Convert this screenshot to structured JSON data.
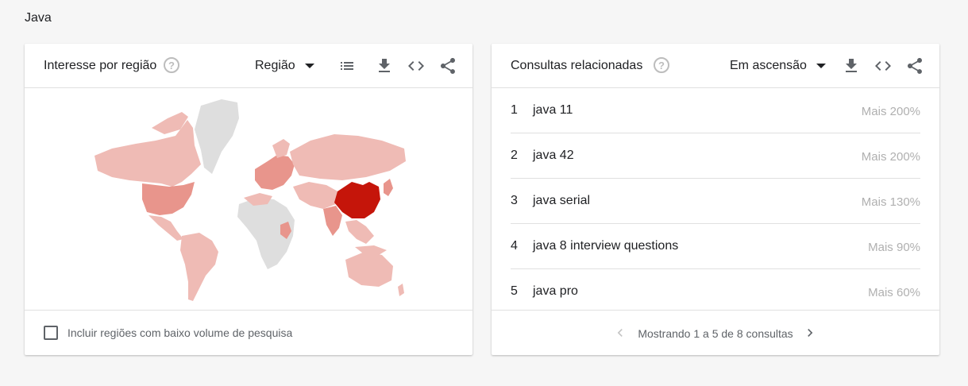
{
  "page": {
    "title": "Java"
  },
  "left_card": {
    "title": "Interesse por região",
    "help_symbol": "?",
    "dropdown_label": "Região",
    "icons": [
      "list-icon",
      "download-icon",
      "embed-icon",
      "share-icon"
    ],
    "checkbox_label": "Incluir regiões com baixo volume de pesquisa",
    "map": {
      "highlight_color": "#c5150a",
      "secondary_color": "#e8958c",
      "low_color": "#efbbb5",
      "no_data_color": "#dedede",
      "top_region": "China"
    }
  },
  "right_card": {
    "title": "Consultas relacionadas",
    "help_symbol": "?",
    "dropdown_label": "Em ascensão",
    "icons": [
      "download-icon",
      "embed-icon",
      "share-icon"
    ],
    "queries": [
      {
        "rank": "1",
        "text": "java 11",
        "value": "Mais 200%"
      },
      {
        "rank": "2",
        "text": "java 42",
        "value": "Mais 200%"
      },
      {
        "rank": "3",
        "text": "java serial",
        "value": "Mais 130%"
      },
      {
        "rank": "4",
        "text": "java 8 interview questions",
        "value": "Mais 90%"
      },
      {
        "rank": "5",
        "text": "java pro",
        "value": "Mais 60%"
      }
    ],
    "pager_text": "Mostrando 1 a 5 de 8 consultas"
  }
}
